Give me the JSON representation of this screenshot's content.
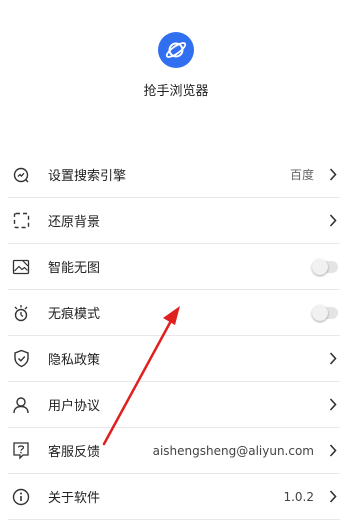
{
  "app": {
    "name": "抢手浏览器"
  },
  "settings": [
    {
      "id": "search-engine",
      "icon": "search-engine-icon",
      "label": "设置搜索引擎",
      "value": "百度",
      "control": "chevron"
    },
    {
      "id": "restore-background",
      "icon": "dashed-square-icon",
      "label": "还原背景",
      "value": "",
      "control": "chevron"
    },
    {
      "id": "smart-no-image",
      "icon": "no-image-icon",
      "label": "智能无图",
      "value": "",
      "control": "toggle",
      "on": false
    },
    {
      "id": "incognito",
      "icon": "incognito-icon",
      "label": "无痕模式",
      "value": "",
      "control": "toggle",
      "on": false
    },
    {
      "id": "privacy-policy",
      "icon": "shield-check-icon",
      "label": "隐私政策",
      "value": "",
      "control": "chevron"
    },
    {
      "id": "user-agreement",
      "icon": "person-icon",
      "label": "用户协议",
      "value": "",
      "control": "chevron"
    },
    {
      "id": "feedback",
      "icon": "feedback-question-icon",
      "label": "客服反馈",
      "value": "aishengsheng@aliyun.com",
      "control": "chevron"
    },
    {
      "id": "about",
      "icon": "info-icon",
      "label": "关于软件",
      "value": "1.0.2",
      "control": "chevron"
    }
  ],
  "colors": {
    "brand": "#2f6ff0",
    "annotation_arrow": "#e0201e"
  }
}
